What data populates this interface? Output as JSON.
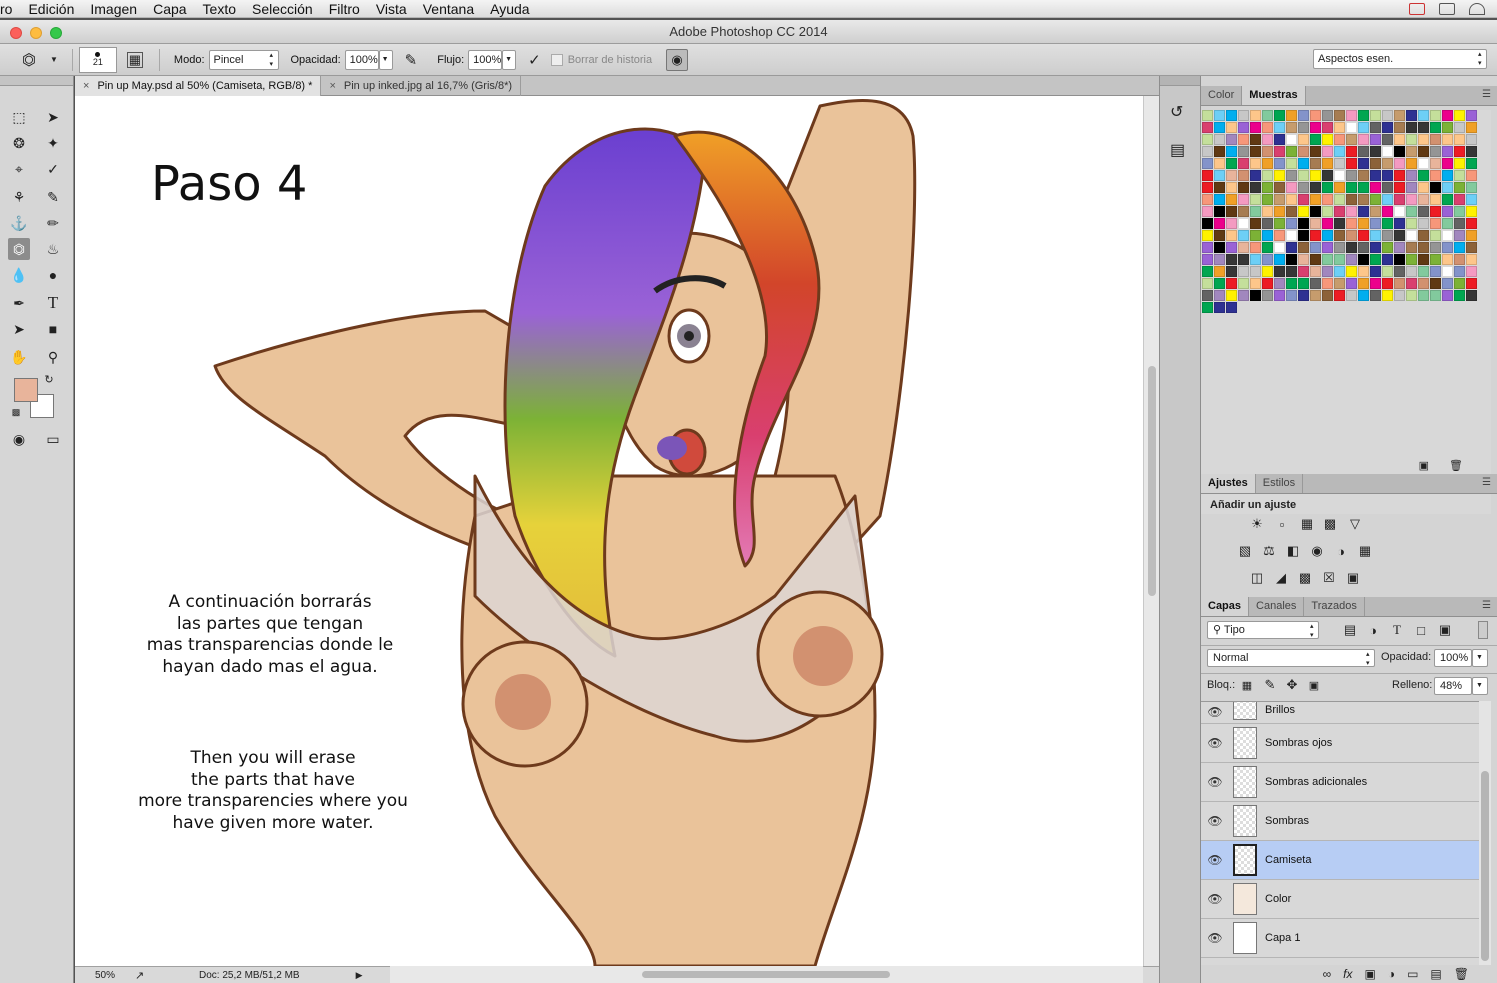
{
  "menubar": {
    "items": [
      "ro",
      "Edición",
      "Imagen",
      "Capa",
      "Texto",
      "Selección",
      "Filtro",
      "Vista",
      "Ventana",
      "Ayuda"
    ]
  },
  "window": {
    "title": "Adobe Photoshop CC 2014"
  },
  "options": {
    "brush_size": "21",
    "mode_label": "Modo:",
    "mode_value": "Pincel",
    "opacity_label": "Opacidad:",
    "opacity_value": "100%",
    "flow_label": "Flujo:",
    "flow_value": "100%",
    "erase_history": "Borrar de historia",
    "workspace": "Aspectos esen."
  },
  "tabs": [
    {
      "close": "×",
      "label": "Pin up May.psd al 50% (Camiseta, RGB/8) *"
    },
    {
      "close": "×",
      "label": "Pin up inked.jpg al 16,7% (Gris/8*)"
    }
  ],
  "canvas": {
    "heading": "Paso 4",
    "text_es": [
      "A continuación borrarás",
      "las partes que tengan",
      "mas transparencias donde le",
      "hayan dado mas el agua."
    ],
    "text_en": [
      "Then you will erase",
      "the parts that have",
      "more transparencies where you",
      "have given more water."
    ]
  },
  "status": {
    "zoom": "50%",
    "doc": "Doc: 25,2 MB/51,2 MB"
  },
  "colors": {
    "foreground": "#e8b49b",
    "background": "#ffffff",
    "layer_selected": "#b7cdf4"
  },
  "swatches_panel": {
    "tabs": [
      "Color",
      "Muestras"
    ]
  },
  "adjust_panel": {
    "tabs": [
      "Ajustes",
      "Estilos"
    ],
    "heading": "Añadir un ajuste"
  },
  "layers_panel": {
    "tabs": [
      "Capas",
      "Canales",
      "Trazados"
    ],
    "filter": "Tipo",
    "blend_mode": "Normal",
    "opacity_label": "Opacidad:",
    "opacity_value": "100%",
    "lock_label": "Bloq.:",
    "fill_label": "Relleno:",
    "fill_value": "48%",
    "layers": [
      {
        "name": "Brillos",
        "selected": false
      },
      {
        "name": "Sombras ojos",
        "selected": false
      },
      {
        "name": "Sombras adicionales",
        "selected": false
      },
      {
        "name": "Sombras",
        "selected": false
      },
      {
        "name": "Camiseta",
        "selected": true
      },
      {
        "name": "Color",
        "selected": false
      },
      {
        "name": "Capa 1",
        "selected": false
      }
    ],
    "footer_icons": [
      "link-icon",
      "fx-icon",
      "mask-icon",
      "adjustment-icon",
      "folder-icon",
      "new-layer-icon",
      "trash-icon"
    ]
  }
}
